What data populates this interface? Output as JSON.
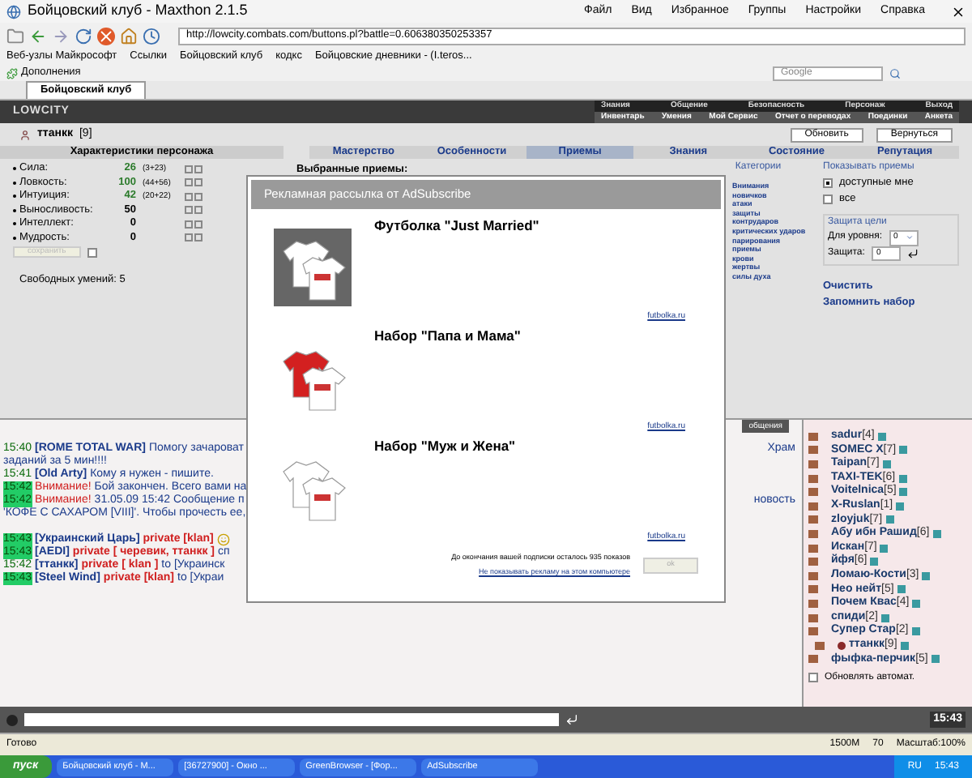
{
  "window": {
    "title": "Бойцовский клуб - Maxthon 2.1.5",
    "menu": [
      "Файл",
      "Вид",
      "Избранное",
      "Группы",
      "Настройки",
      "Справка"
    ]
  },
  "address": {
    "value": "http://lowcity.combats.com/buttons.pl?battle=0.606380350253357"
  },
  "links": [
    "Веб-узлы Майкрософт",
    "Ссылки",
    "Бойцовский клуб",
    "кодкс",
    "Бойцовские дневники - (I.teros..."
  ],
  "addons": {
    "label": "Дополнения",
    "search_placeholder": "Google"
  },
  "tabs": [
    {
      "label": "Бойцовский клуб",
      "selected": true
    }
  ],
  "game": {
    "logo": "LOWCITY",
    "nav_top": [
      "Знания",
      "Общение",
      "Безопасность",
      "Персонаж",
      "Выход"
    ],
    "nav_bottom": [
      "Инвентарь",
      "Умения",
      "Мой Сервис",
      "Отчет о переводах",
      "Поединки",
      "Анкета"
    ]
  },
  "character": {
    "name": "ттанкк",
    "level": "[9]",
    "buttons": [
      "Обновить",
      "Вернуться"
    ]
  },
  "stats_title": "Характеристики персонажа",
  "sections": [
    {
      "label": "Мастерство",
      "selected": false
    },
    {
      "label": "Особенности",
      "selected": false
    },
    {
      "label": "Приемы",
      "selected": true
    },
    {
      "label": "Знания",
      "selected": false
    },
    {
      "label": "Состояние",
      "selected": false
    },
    {
      "label": "Репутация",
      "selected": false
    }
  ],
  "stats": [
    {
      "name": "Сила:",
      "value": "26",
      "bonus": "(3+23)",
      "boosted": true
    },
    {
      "name": "Ловкость:",
      "value": "100",
      "bonus": "(44+56)",
      "boosted": true
    },
    {
      "name": "Интуиция:",
      "value": "42",
      "bonus": "(20+22)",
      "boosted": true
    },
    {
      "name": "Выносливость:",
      "value": "50",
      "boosted": false
    },
    {
      "name": "Интеллект:",
      "value": "0",
      "boosted": false
    },
    {
      "name": "Мудрость:",
      "value": "0",
      "boosted": false
    }
  ],
  "save_button": {
    "label": "сохранить",
    "disabled": true,
    "checked": false
  },
  "free_skills": "Свободных умений: 5",
  "selected_moves": "Выбранные приемы:",
  "categories": {
    "title": "Категории",
    "items": [
      "Внимания",
      "новичков",
      "атаки",
      "защиты",
      "контрударов",
      "критических ударов",
      "парирования",
      "приемы",
      "крови",
      "жертвы",
      "силы духа"
    ]
  },
  "show_moves": {
    "title": "Показывать приемы",
    "options": [
      {
        "label": "доступные мне",
        "selected": true
      },
      {
        "label": "все",
        "selected": false
      }
    ]
  },
  "target_defense": {
    "title": "Защита цели",
    "level_label": "Для уровня:",
    "level_value": "0",
    "defense_label": "Защита:",
    "defense_value": "0"
  },
  "actions": [
    "Очистить",
    "Запомнить набор"
  ],
  "chat": {
    "tab": "общения",
    "lines": [
      {
        "time": "15:40",
        "highlighted": false,
        "parts": [
          {
            "kind": "nick",
            "text": "[ROME TOTAL WAR]"
          },
          {
            "kind": "text",
            "text": "Помогу зачароват"
          }
        ],
        "right": "Храм"
      },
      {
        "parts": [
          {
            "kind": "text",
            "text": "заданий за 5 мин!!!!"
          }
        ]
      },
      {
        "time": "15:41",
        "highlighted": false,
        "parts": [
          {
            "kind": "nick",
            "text": "[Old Arty]"
          },
          {
            "kind": "text",
            "text": "Кому я нужен - пишите."
          }
        ]
      },
      {
        "time": "15:42",
        "highlighted": true,
        "parts": [
          {
            "kind": "alert",
            "text": "Внимание!"
          },
          {
            "kind": "text",
            "text": "Бой закончен. Всего вами на"
          }
        ]
      },
      {
        "time": "15:42",
        "highlighted": true,
        "parts": [
          {
            "kind": "alert",
            "text": "Внимание!"
          },
          {
            "kind": "text",
            "text": "31.05.09 15:42 Сообщение п"
          }
        ],
        "right": "новость"
      },
      {
        "parts": [
          {
            "kind": "text",
            "text": "'КОФЕ С САХАРОМ [VIII]'. Чтобы прочесть ее,"
          }
        ]
      },
      {
        "time": "15:43",
        "highlighted": true,
        "gap": true,
        "parts": [
          {
            "kind": "nick",
            "text": "[Украинский Царь]"
          },
          {
            "kind": "private",
            "text": "private [klan]"
          },
          {
            "kind": "smiley"
          }
        ]
      },
      {
        "time": "15:43",
        "highlighted": true,
        "parts": [
          {
            "kind": "nick",
            "text": "[AEDI]"
          },
          {
            "kind": "private",
            "text": "private [ черевик, ттанкк ]"
          },
          {
            "kind": "text",
            "text": "сп"
          }
        ]
      },
      {
        "time": "15:42",
        "highlighted": false,
        "parts": [
          {
            "kind": "nick",
            "text": "[ттанкк]"
          },
          {
            "kind": "private",
            "text": "private [ klan ]"
          },
          {
            "kind": "text",
            "text": "to [Украинск"
          }
        ]
      },
      {
        "time": "15:43",
        "highlighted": true,
        "parts": [
          {
            "kind": "nick",
            "text": "[Steel Wind]"
          },
          {
            "kind": "private",
            "text": "private [klan]"
          },
          {
            "kind": "text",
            "text": "to [Украи"
          }
        ]
      }
    ]
  },
  "online": {
    "users": [
      {
        "name": "sadur",
        "level": "[4]",
        "self": false
      },
      {
        "name": "SOMEC X",
        "level": "[7]",
        "self": false
      },
      {
        "name": "Taipan",
        "level": "[7]",
        "self": false
      },
      {
        "name": "TAXI-TEK",
        "level": "[6]",
        "self": false
      },
      {
        "name": "Voitelnica",
        "level": "[5]",
        "self": false
      },
      {
        "name": "X-Ruslan",
        "level": "[1]",
        "self": false
      },
      {
        "name": "zloyjuk",
        "level": "[7]",
        "self": false
      },
      {
        "name": "Абу ибн Рашид",
        "level": "[6]",
        "self": false
      },
      {
        "name": "Искан",
        "level": "[7]",
        "self": false
      },
      {
        "name": "йфя",
        "level": "[6]",
        "self": false
      },
      {
        "name": "Ломаю-Кости",
        "level": "[3]",
        "self": false
      },
      {
        "name": "Нео нейт",
        "level": "[5]",
        "self": false
      },
      {
        "name": "Почем Квас",
        "level": "[4]",
        "self": false
      },
      {
        "name": "спиди",
        "level": "[2]",
        "self": false
      },
      {
        "name": "Супер Стар",
        "level": "[2]",
        "self": false
      },
      {
        "name": "ттанкк",
        "level": "[9]",
        "self": true
      },
      {
        "name": "фыфка-перчик",
        "level": "[5]",
        "self": false
      }
    ],
    "auto_refresh": {
      "label": "Обновлять автомат.",
      "checked": false
    }
  },
  "chat_clock": "15:43",
  "popup": {
    "title": "Рекламная рассылка от AdSubscribe",
    "items": [
      {
        "title": "Футболка \"Just Married\"",
        "link": "futbolka.ru"
      },
      {
        "title": "Набор \"Папа и Мама\"",
        "link": "futbolka.ru"
      },
      {
        "title": "Набор \"Муж и Жена\"",
        "link": "futbolka.ru"
      }
    ],
    "remaining": "До окончания вашей подписки осталось 935 показов",
    "hide_link": "Не показывать рекламу на этом компьютере",
    "button": "ok"
  },
  "status_bar": {
    "text": "Готово",
    "memory": "1500M",
    "count": "70",
    "zoom": "Масштаб:100%"
  },
  "taskbar": {
    "start": "пуск",
    "items": [
      "Бойцовский клуб - M...",
      "[36727900] - Окно ...",
      "GreenBrowser - [Фор...",
      "AdSubscribe"
    ],
    "lang": "RU",
    "clock": "15:43"
  }
}
